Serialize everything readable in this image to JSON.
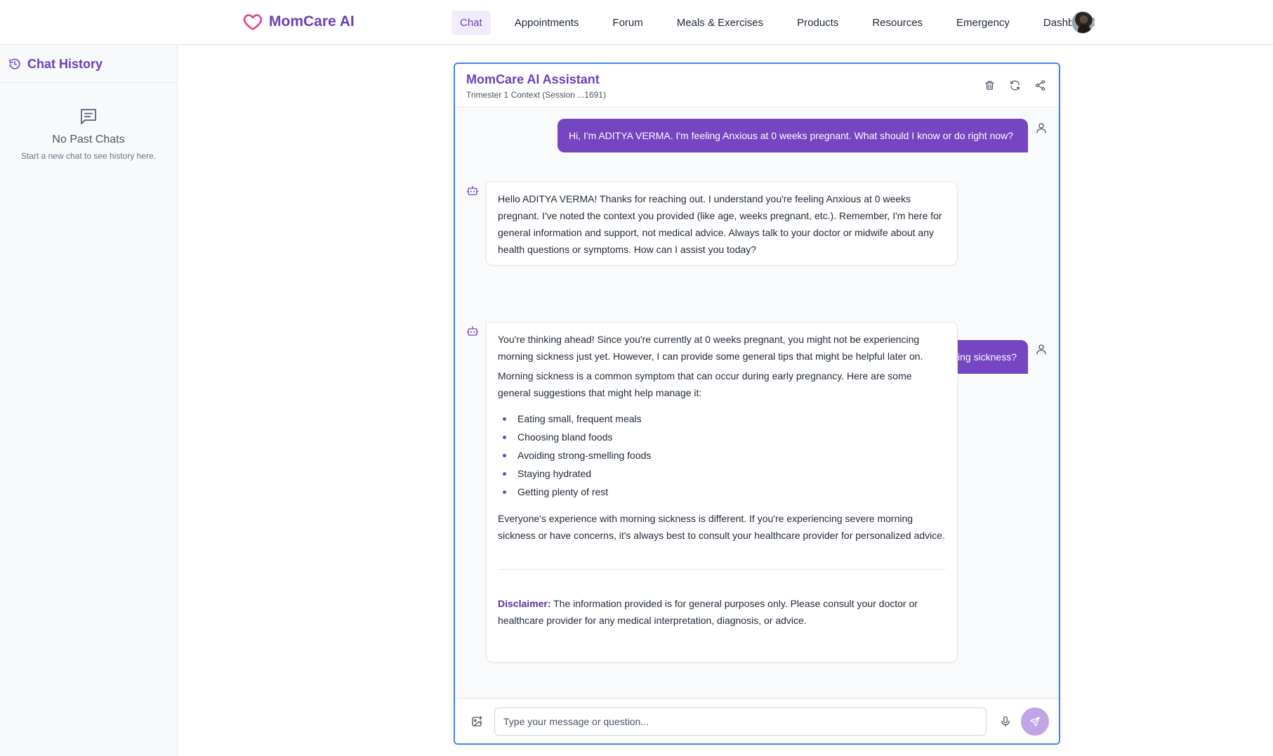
{
  "app": {
    "name": "MomCare AI",
    "accent_color": "#6d3fb8",
    "logo_icon": "heart-icon"
  },
  "nav": {
    "items": [
      {
        "label": "Chat",
        "active": true
      },
      {
        "label": "Appointments"
      },
      {
        "label": "Forum"
      },
      {
        "label": "Meals & Exercises"
      },
      {
        "label": "Products"
      },
      {
        "label": "Resources"
      },
      {
        "label": "Emergency"
      },
      {
        "label": "Dashboard"
      }
    ]
  },
  "sidebar": {
    "title": "Chat History",
    "title_icon": "history-icon",
    "empty_icon": "message-icon",
    "empty_title": "No Past Chats",
    "empty_subtitle": "Start a new chat to see history here."
  },
  "chat": {
    "title": "MomCare AI Assistant",
    "subtitle": "Trimester 1 Context (Session ...1691)",
    "actions": [
      "trash-icon",
      "refresh-icon",
      "share-icon"
    ],
    "messages": {
      "user1": "Hi, I'm ADITYA VERMA. I'm feeling Anxious at 0 weeks pregnant. What should I know or do right now?",
      "bot1": "Hello ADITYA VERMA! Thanks for reaching out. I understand you're feeling Anxious at 0 weeks pregnant. I've noted the context you provided (like age, weeks pregnant, etc.). Remember, I'm here for general information and support, not medical advice. Always talk to your doctor or midwife about any health questions or symptoms. How can I assist you today?",
      "user2": "How can I manage morning sickness?",
      "bot2": {
        "p1": "You're thinking ahead! Since you're currently at 0 weeks pregnant, you might not be experiencing morning sickness just yet. However, I can provide some general tips that might be helpful later on.",
        "p2": "Morning sickness is a common symptom that can occur during early pregnancy. Here are some general suggestions that might help manage it:",
        "list": [
          "Eating small, frequent meals",
          "Choosing bland foods",
          "Avoiding strong-smelling foods",
          "Staying hydrated",
          "Getting plenty of rest"
        ],
        "p3": "Everyone's experience with morning sickness is different. If you're experiencing severe morning sickness or have concerns, it's always best to consult your healthcare provider for personalized advice.",
        "disclaimer_label": "Disclaimer:",
        "disclaimer_text": " The information provided is for general purposes only. Please consult your doctor or healthcare provider for any medical interpretation, diagnosis, or advice."
      }
    },
    "composer": {
      "placeholder": "Type your message or question...",
      "value": ""
    }
  }
}
